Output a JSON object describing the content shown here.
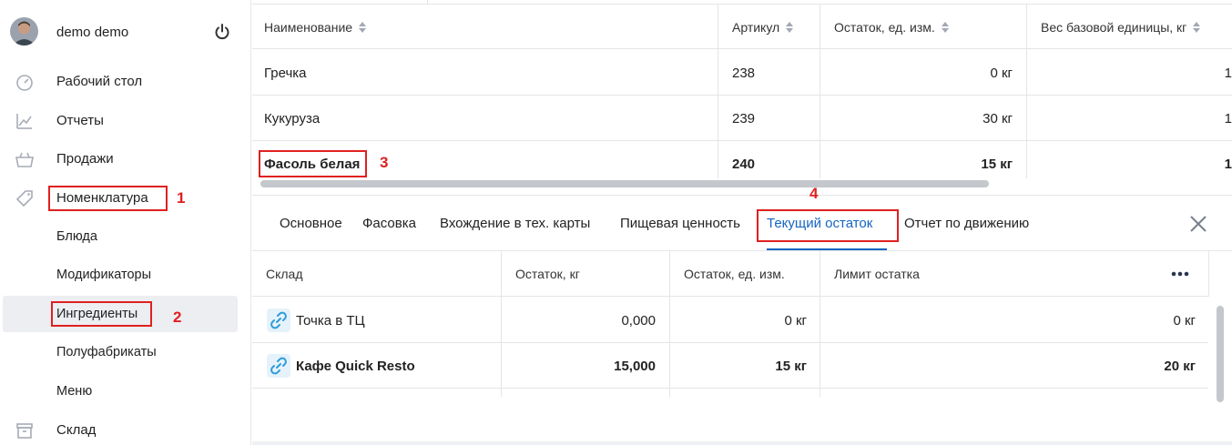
{
  "user": {
    "name": "demo demo"
  },
  "nav": {
    "items": [
      {
        "label": "Рабочий стол",
        "icon": "dashboard-icon"
      },
      {
        "label": "Отчеты",
        "icon": "chart-icon"
      },
      {
        "label": "Продажи",
        "icon": "basket-icon"
      },
      {
        "label": "Номенклатура",
        "icon": "tag-icon"
      }
    ],
    "subitems": [
      {
        "label": "Блюда"
      },
      {
        "label": "Модификаторы"
      },
      {
        "label": "Ингредиенты"
      },
      {
        "label": "Полуфабрикаты"
      },
      {
        "label": "Меню"
      }
    ],
    "bottom_item": {
      "label": "Склад",
      "icon": "warehouse-icon"
    },
    "active_subitem": "Ингредиенты"
  },
  "markers": {
    "m1": "1",
    "m2": "2",
    "m3": "3",
    "m4": "4"
  },
  "products": {
    "columns": [
      "Наименование",
      "Артикул",
      "Остаток, ед. изм.",
      "Вес базовой единицы, кг"
    ],
    "rows": [
      {
        "name": "Гречка",
        "article": "238",
        "stock": "0 кг",
        "weight": "1"
      },
      {
        "name": "Кукуруза",
        "article": "239",
        "stock": "30 кг",
        "weight": "1"
      },
      {
        "name": "Фасоль белая",
        "article": "240",
        "stock": "15 кг",
        "weight": "1"
      }
    ]
  },
  "tabs": {
    "items": [
      "Основное",
      "Фасовка",
      "Вхождение в тех. карты",
      "Пищевая ценность",
      "Текущий остаток",
      "Отчет по движению"
    ],
    "active": "Текущий остаток"
  },
  "stock_table": {
    "columns": [
      "Склад",
      "Остаток, кг",
      "Остаток, ед. изм.",
      "Лимит остатка"
    ],
    "rows": [
      {
        "warehouse": "Точка в ТЦ",
        "kg": "0,000",
        "units": "0 кг",
        "limit": "0 кг"
      },
      {
        "warehouse": "Кафе Quick Resto",
        "kg": "15,000",
        "units": "15 кг",
        "limit": "20 кг"
      }
    ]
  },
  "colors": {
    "accent": "#1565c0",
    "annotation": "#e02020",
    "link_icon": "#2d9cdb"
  }
}
